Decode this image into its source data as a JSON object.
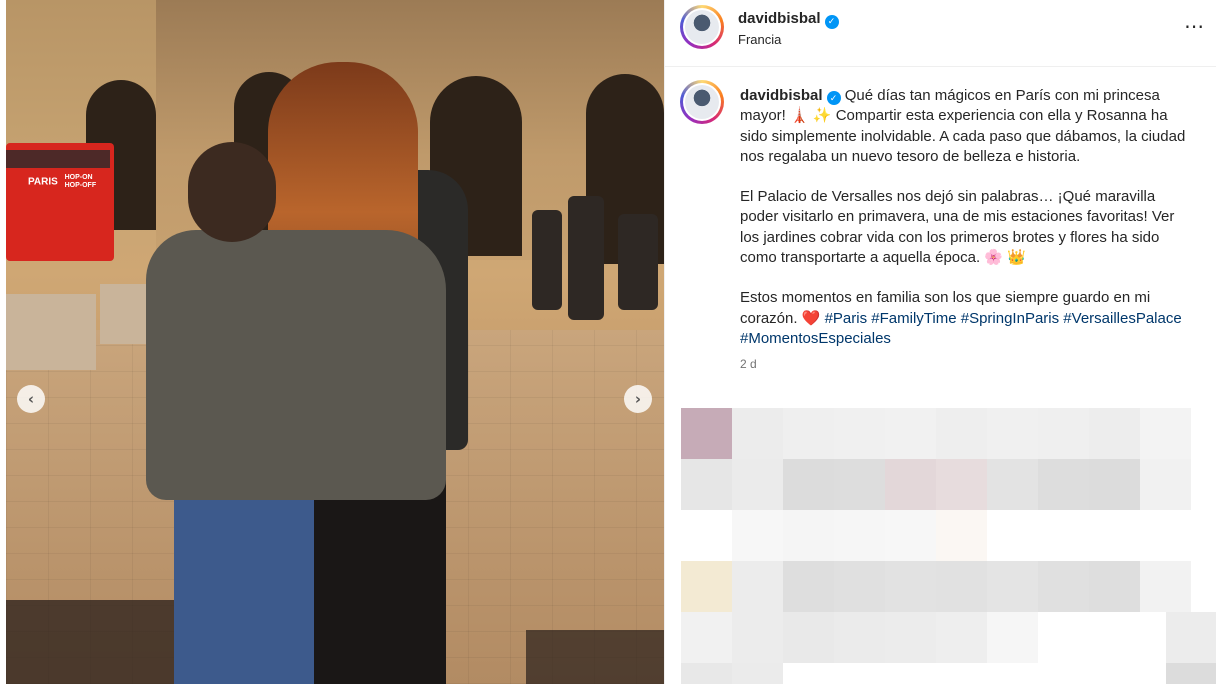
{
  "post": {
    "username": "davidbisbal",
    "location": "Francia",
    "more_icon": "⋯",
    "prev_icon": "‹",
    "next_icon": "›"
  },
  "photo": {
    "bus_sign_1": "PARIS",
    "bus_sign_2": "HOP-ON",
    "bus_sign_3": "HOP-OFF"
  },
  "caption": {
    "username": "davidbisbal",
    "p1": "Qué días tan mágicos en París con mi princesa mayor! 🗼 ✨ Compartir esta experiencia con ella y Rosanna ha sido simplemente inolvidable. A cada paso que dábamos, la ciudad nos regalaba un nuevo tesoro de belleza e historia.",
    "p2": "El Palacio de Versalles nos dejó sin palabras… ¡Qué maravilla poder visitarlo en primavera, una de mis estaciones favoritas! Ver los jardines cobrar vida con los primeros brotes y flores ha sido como transportarte a aquella época. 🌸 👑",
    "p3_text": "Estos momentos en familia son los que siempre guardo en mi corazón. ❤️",
    "hashtags": [
      "#Paris",
      "#FamilyTime",
      "#SpringInParis",
      "#VersaillesPalace",
      "#MomentosEspeciales"
    ]
  },
  "time_ago": "2 d",
  "colors": {
    "link": "#00376b",
    "verified": "#0095f6",
    "secondary_text": "#737373"
  }
}
